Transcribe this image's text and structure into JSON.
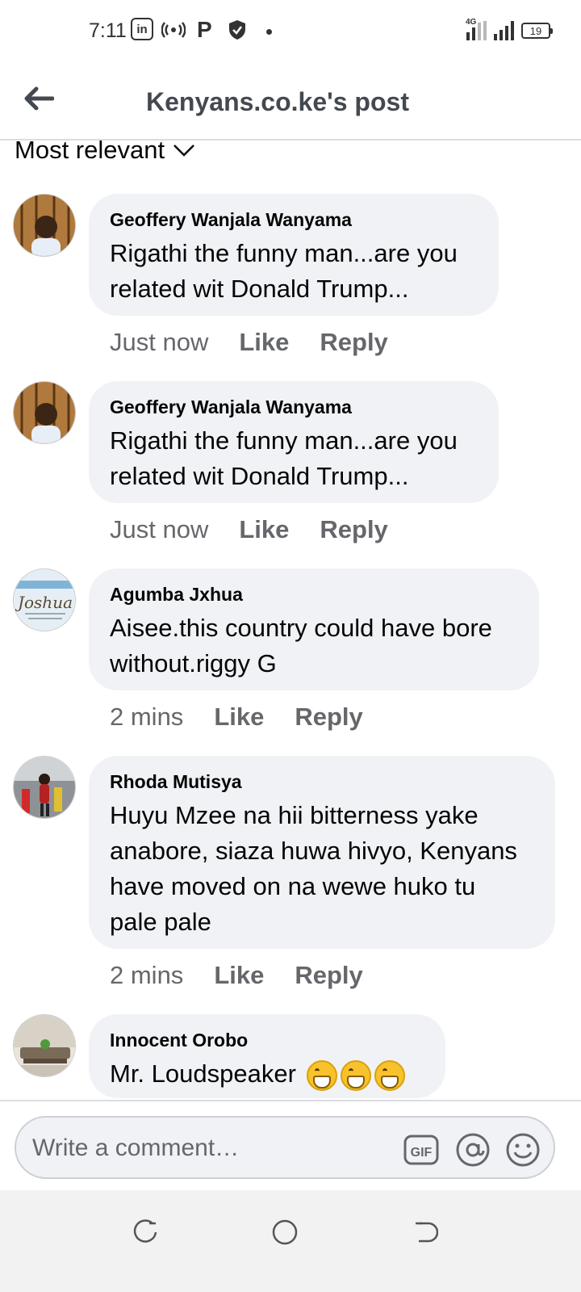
{
  "status_bar": {
    "time": "7:11",
    "network": "4G",
    "battery": "19"
  },
  "header": {
    "title": "Kenyans.co.ke's post"
  },
  "sort": {
    "label": "Most relevant"
  },
  "comments": [
    {
      "author": "Geoffery Wanjala Wanyama",
      "lines": [
        "Rigathi the funny man...are you",
        "related wit Donald Trump..."
      ],
      "time": "Just now",
      "like": "Like",
      "reply": "Reply"
    },
    {
      "author": "Geoffery Wanjala Wanyama",
      "lines": [
        "Rigathi the funny man...are you",
        "related wit Donald Trump..."
      ],
      "time": "Just now",
      "like": "Like",
      "reply": "Reply"
    },
    {
      "author": "Agumba Jxhua",
      "lines": [
        "Aisee.this country could have bore",
        "without.riggy G"
      ],
      "time": "2 mins",
      "like": "Like",
      "reply": "Reply",
      "avatar_text": "Joshua"
    },
    {
      "author": "Rhoda Mutisya",
      "lines": [
        "Huyu Mzee na hii bitterness yake",
        "anabore, siaza huwa hivyo, Kenyans",
        "have moved on na wewe huko tu",
        "pale pale"
      ],
      "time": "2 mins",
      "like": "Like",
      "reply": "Reply"
    },
    {
      "author": "Innocent Orobo",
      "lines": [
        "Mr. Loudspeaker"
      ],
      "time": "",
      "like": "",
      "reply": ""
    }
  ],
  "composer": {
    "placeholder": "Write a comment…",
    "gif_label": "GIF"
  },
  "colors": {
    "bubble": "#f0f2f5",
    "meta_text": "#65676b",
    "divider": "#dadde1"
  }
}
